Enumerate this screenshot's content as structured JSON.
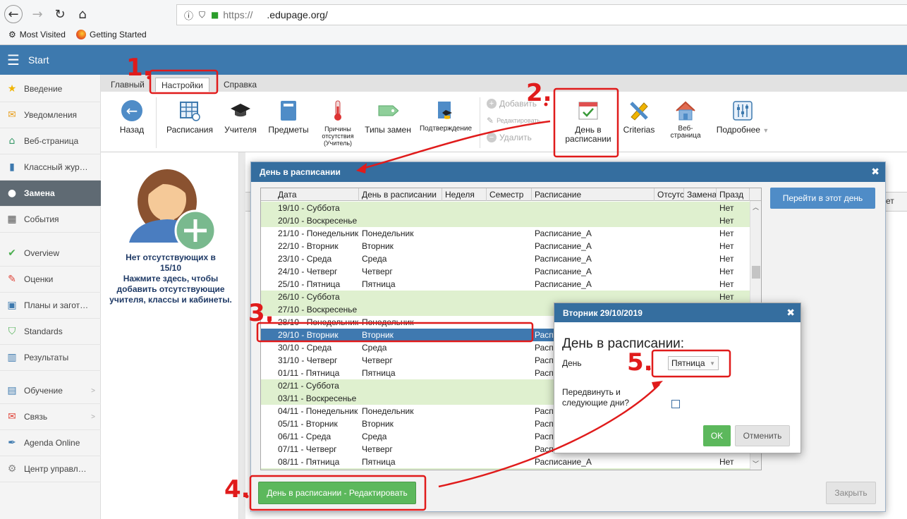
{
  "browser": {
    "url_prefix": "https://",
    "url_domain": ".edupage.org/",
    "bookmarks": [
      "Most Visited",
      "Getting Started"
    ]
  },
  "app": {
    "title": "Start"
  },
  "sidebar": [
    {
      "label": "Введение",
      "icon": "star-icon",
      "color": "#f0b400"
    },
    {
      "label": "Уведомления",
      "icon": "envelope-icon",
      "color": "#e8a020"
    },
    {
      "label": "Веб-страница",
      "icon": "home-icon",
      "color": "#3a9a6a"
    },
    {
      "label": "Классный жур…",
      "icon": "book-icon",
      "color": "#3d79ae"
    },
    {
      "label": "Замена",
      "icon": "user-icon",
      "color": "#ffffff"
    },
    {
      "label": "События",
      "icon": "calendar-icon",
      "color": "#555555"
    },
    {
      "label": "Overview",
      "icon": "check-circle-icon",
      "color": "#4caf50"
    },
    {
      "label": "Оценки",
      "icon": "grade-icon",
      "color": "#e0453a"
    },
    {
      "label": "Планы и загот…",
      "icon": "briefcase-icon",
      "color": "#3d79ae"
    },
    {
      "label": "Standards",
      "icon": "shield-icon",
      "color": "#4caf50"
    },
    {
      "label": "Результаты",
      "icon": "chart-icon",
      "color": "#3d79ae"
    },
    {
      "label": "Обучение",
      "icon": "education-icon",
      "color": "#3d79ae"
    },
    {
      "label": "Связь",
      "icon": "chat-icon",
      "color": "#e0453a"
    },
    {
      "label": "Agenda Online",
      "icon": "pen-icon",
      "color": "#3d79ae"
    },
    {
      "label": "Центр управл…",
      "icon": "gear-icon",
      "color": "#888888"
    }
  ],
  "tabs": [
    "Главный",
    "Настройки",
    "Справка"
  ],
  "ribbon": {
    "back": "Назад",
    "timetables": "Расписания",
    "teachers": "Учителя",
    "subjects": "Предметы",
    "absence_reasons": [
      "Причины",
      "отсутствия",
      "(Учитель)"
    ],
    "sub_types": "Типы замен",
    "confirmation": "Подтверждение",
    "add": "Добавить",
    "edit": "Редактировать",
    "delete": "Удалить",
    "day_in_timetable": [
      "День в",
      "расписании"
    ],
    "criterias": "Criterias",
    "webpage": "Веб-страница",
    "more": "Подробнее"
  },
  "left_panel": {
    "lines": [
      "Нет отсутствующих в",
      "15/10",
      "Нажмите здесь, чтобы",
      "добавить отсутствующие",
      "учителя, классы и кабинеты."
    ]
  },
  "dialog": {
    "title": "День в расписании",
    "goto_button": "Перейти в этот день",
    "edit_button": "День в расписании - Редактировать",
    "close_button": "Закрыть",
    "behind_text": "ет",
    "columns": [
      "Дата",
      "День в расписании",
      "Неделя",
      "Семестр",
      "Расписание",
      "Отсутс",
      "Замена",
      "Празд"
    ],
    "rows": [
      {
        "date": "19/10 - Суббота",
        "day": "",
        "tt": "",
        "hol": "Нет",
        "kind": "green"
      },
      {
        "date": "20/10 - Воскресенье",
        "day": "",
        "tt": "",
        "hol": "Нет",
        "kind": "green"
      },
      {
        "date": "21/10 - Понедельник",
        "day": "Понедельник",
        "tt": "Расписание_А",
        "hol": "Нет",
        "kind": "white"
      },
      {
        "date": "22/10 - Вторник",
        "day": "Вторник",
        "tt": "Расписание_А",
        "hol": "Нет",
        "kind": "white"
      },
      {
        "date": "23/10 - Среда",
        "day": "Среда",
        "tt": "Расписание_А",
        "hol": "Нет",
        "kind": "white"
      },
      {
        "date": "24/10 - Четверг",
        "day": "Четверг",
        "tt": "Расписание_А",
        "hol": "Нет",
        "kind": "white"
      },
      {
        "date": "25/10 - Пятница",
        "day": "Пятница",
        "tt": "Расписание_А",
        "hol": "Нет",
        "kind": "white"
      },
      {
        "date": "26/10 - Суббота",
        "day": "",
        "tt": "",
        "hol": "Нет",
        "kind": "green"
      },
      {
        "date": "27/10 - Воскресенье",
        "day": "",
        "tt": "",
        "hol": "",
        "kind": "green"
      },
      {
        "date": "28/10 - Понедельник",
        "day": "Понедельник",
        "tt": "",
        "hol": "",
        "kind": "white"
      },
      {
        "date": "29/10 - Вторник",
        "day": "Вторник",
        "tt": "Расп",
        "hol": "",
        "kind": "sel"
      },
      {
        "date": "30/10 - Среда",
        "day": "Среда",
        "tt": "Расп",
        "hol": "",
        "kind": "white"
      },
      {
        "date": "31/10 - Четверг",
        "day": "Четверг",
        "tt": "Расп",
        "hol": "",
        "kind": "white"
      },
      {
        "date": "01/11 - Пятница",
        "day": "Пятница",
        "tt": "Расп",
        "hol": "",
        "kind": "white"
      },
      {
        "date": "02/11 - Суббота",
        "day": "",
        "tt": "",
        "hol": "",
        "kind": "green"
      },
      {
        "date": "03/11 - Воскресенье",
        "day": "",
        "tt": "",
        "hol": "",
        "kind": "green"
      },
      {
        "date": "04/11 - Понедельник",
        "day": "Понедельник",
        "tt": "Расп",
        "hol": "",
        "kind": "white"
      },
      {
        "date": "05/11 - Вторник",
        "day": "Вторник",
        "tt": "Расп",
        "hol": "",
        "kind": "white"
      },
      {
        "date": "06/11 - Среда",
        "day": "Среда",
        "tt": "Расп",
        "hol": "",
        "kind": "white"
      },
      {
        "date": "07/11 - Четверг",
        "day": "Четверг",
        "tt": "Расп",
        "hol": "",
        "kind": "white"
      },
      {
        "date": "08/11 - Пятница",
        "day": "Пятница",
        "tt": "Расписание_А",
        "hol": "Нет",
        "kind": "white"
      },
      {
        "date": "",
        "day": "",
        "tt": "",
        "hol": "Нет",
        "kind": "green"
      }
    ]
  },
  "subdialog": {
    "title": "Вторник 29/10/2019",
    "heading": "День в расписании:",
    "day_label": "День",
    "day_value": "Пятница",
    "move_label": [
      "Передвинуть и",
      "следующие дни?"
    ],
    "ok": "OK",
    "cancel": "Отменить"
  },
  "annotations": {
    "step1": "1.",
    "step2": "2.",
    "step3": "3.",
    "step4": "4.",
    "step5": "5."
  }
}
